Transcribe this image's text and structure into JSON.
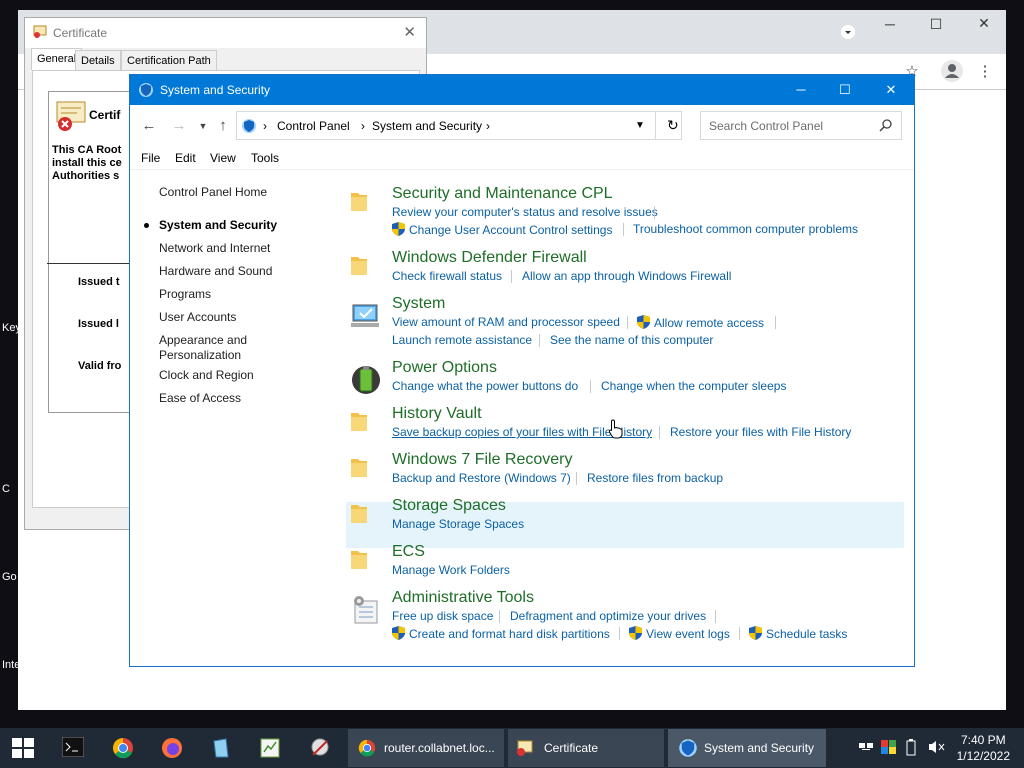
{
  "desktop": {
    "edge_labels": [
      "Key",
      "C",
      "Go",
      "Inte"
    ]
  },
  "certificate_window": {
    "title": "Certificate",
    "tabs": [
      "General",
      "Details",
      "Certification Path"
    ],
    "info_heading": "Certif",
    "body_lines": [
      "This CA Root",
      "install this ce",
      "Authorities s"
    ],
    "issued_to": "Issued t",
    "issued_by": "Issued l",
    "valid_from": "Valid fro"
  },
  "window": {
    "title": "System and Security",
    "address": [
      "Control Panel",
      "System and Security"
    ],
    "search_placeholder": "Search Control Panel",
    "menu": [
      "File",
      "Edit",
      "View",
      "Tools"
    ]
  },
  "sidebar": {
    "home": "Control Panel Home",
    "items": [
      {
        "label": "System and Security",
        "current": true
      },
      {
        "label": "Network and Internet"
      },
      {
        "label": "Hardware and Sound"
      },
      {
        "label": "Programs"
      },
      {
        "label": "User Accounts"
      },
      {
        "label": "Appearance and"
      },
      {
        "label": "Personalization"
      },
      {
        "label": "Clock and Region"
      },
      {
        "label": "Ease of Access"
      }
    ]
  },
  "categories": {
    "security": {
      "title": "Security and Maintenance CPL",
      "l1": "Review your computer's status and resolve issues",
      "l2": "Change User Account Control settings",
      "l3": "Troubleshoot common computer problems"
    },
    "firewall": {
      "title": "Windows Defender Firewall",
      "l1": "Check firewall status",
      "l2": "Allow an app through Windows Firewall"
    },
    "system": {
      "title": "System",
      "l1": "View amount of RAM and processor speed",
      "l2": "Allow remote access",
      "l3": "Launch remote assistance",
      "l4": "See the name of this computer"
    },
    "power": {
      "title": "Power Options",
      "l1": "Change what the power buttons do",
      "l2": "Change when the computer sleeps"
    },
    "history": {
      "title": "History Vault",
      "l1": "Save backup copies of your files with File History",
      "l2": "Restore your files with File History"
    },
    "win7": {
      "title": "Windows 7 File Recovery",
      "l1": "Backup and Restore (Windows 7)",
      "l2": "Restore files from backup"
    },
    "storage": {
      "title": "Storage Spaces",
      "l1": "Manage Storage Spaces"
    },
    "ecs": {
      "title": "ECS",
      "l1": "Manage Work Folders"
    },
    "admin": {
      "title": "Administrative Tools",
      "l1": "Free up disk space",
      "l2": "Defragment and optimize your drives",
      "l3": "Create and format hard disk partitions",
      "l4": "View event logs",
      "l5": "Schedule tasks"
    }
  },
  "taskbar": {
    "tasks": [
      {
        "label": "router.collabnet.loc..."
      },
      {
        "label": "Certificate"
      },
      {
        "label": "System and Security"
      }
    ],
    "time": "7:40 PM",
    "date": "1/12/2022"
  },
  "colors": {
    "accent": "#0078d7",
    "link": "#0b61a4",
    "category_title": "#1e6e28",
    "taskbar": "#1f2a36",
    "hover_highlight": "#e5f3fb"
  }
}
